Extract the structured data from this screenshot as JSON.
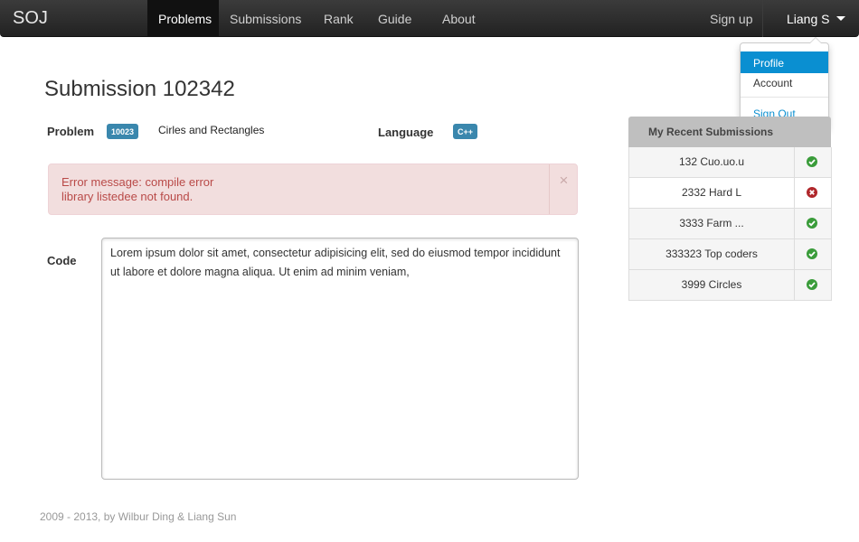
{
  "navbar": {
    "brand": "SOJ",
    "items": [
      {
        "label": "Problems",
        "active": true
      },
      {
        "label": "Submissions"
      },
      {
        "label": "Rank"
      },
      {
        "label": "Guide"
      },
      {
        "label": "About"
      }
    ],
    "signup": "Sign up",
    "user": "Liang S"
  },
  "dropdown": {
    "items": [
      {
        "label": "Profile",
        "active": true
      },
      {
        "label": "Account"
      },
      {
        "label": "Sign Out"
      }
    ]
  },
  "page": {
    "title": "Submission  102342",
    "problem_label": "Problem",
    "problem_id": "10023",
    "problem_name": "Cirles and Rectangles",
    "language_label": "Language",
    "language": "C++",
    "error_line1": "Error message: compile error",
    "error_line2": "library listedee not found.",
    "close_symbol": "×",
    "code_label": "Code",
    "code_text": "Lorem ipsum dolor sit amet, consectetur adipisicing elit, sed do eiusmod tempor incididunt ut labore et dolore magna aliqua. Ut enim ad minim veniam,"
  },
  "recent": {
    "header": "My Recent Submissions",
    "rows": [
      {
        "name": "132 Cuo.uo.u",
        "status": "accepted"
      },
      {
        "name": "2332 Hard L",
        "status": "error"
      },
      {
        "name": "3333 Farm ...",
        "status": "accepted"
      },
      {
        "name": "333323 Top coders",
        "status": "accepted"
      },
      {
        "name": "3999 Circles",
        "status": "accepted"
      }
    ]
  },
  "footer": "2009 - 2013, by Wilbur Ding & Liang Sun",
  "colors": {
    "accent": "#0a8fd1",
    "badge": "#3a87ad",
    "error_bg": "#f2dede",
    "error_text": "#b94a48",
    "ok": "#3a9c3a",
    "fail": "#b0272b"
  }
}
